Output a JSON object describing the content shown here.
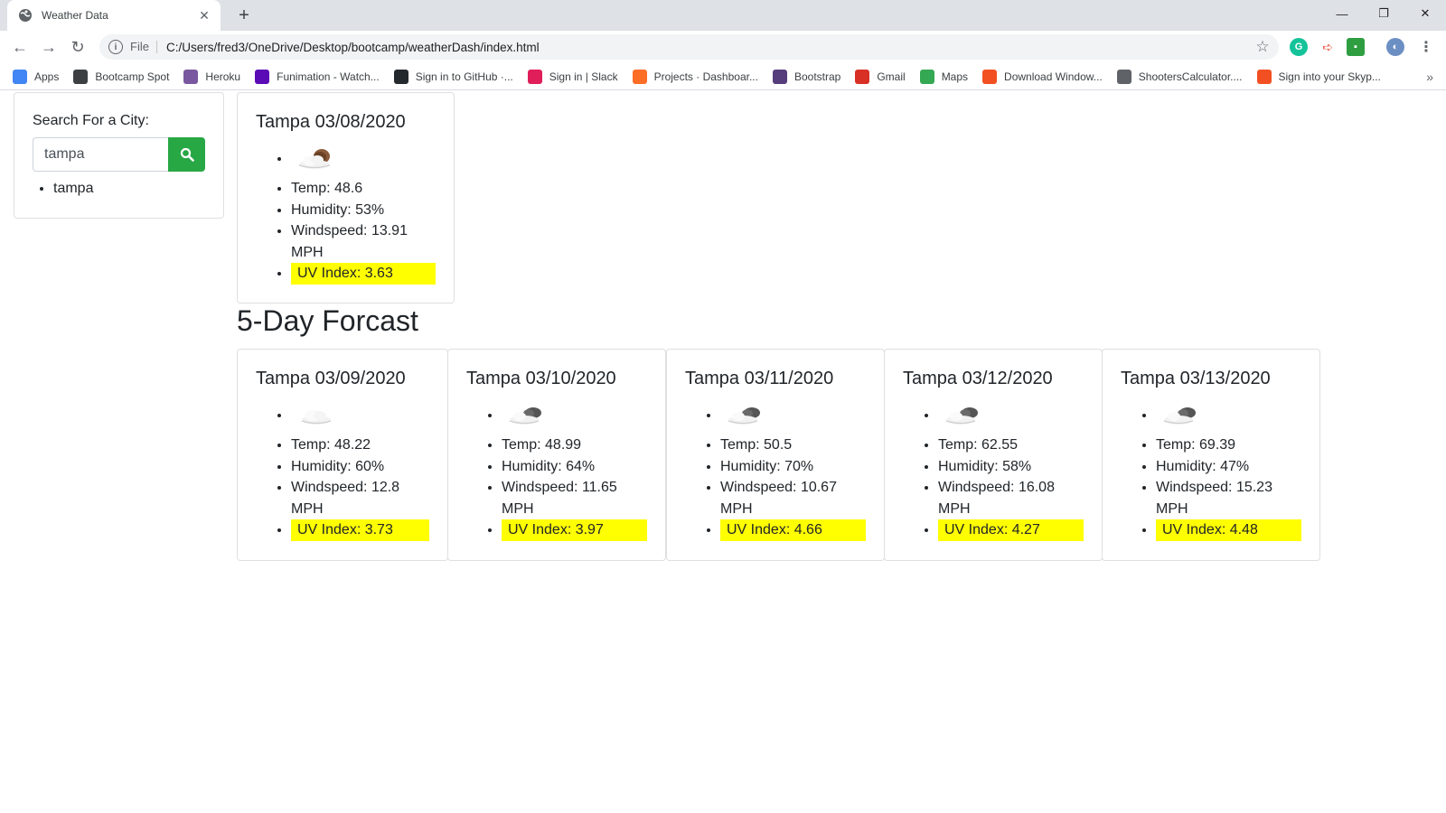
{
  "browser": {
    "tab_title": "Weather Data",
    "url_scheme": "File",
    "url": "C:/Users/fred3/OneDrive/Desktop/bootcamp/weatherDash/index.html",
    "bookmarks": [
      {
        "label": "Apps",
        "icon": "apps-grid-icon",
        "color": "#4285f4"
      },
      {
        "label": "Bootcamp Spot",
        "icon": "bootcamp-spot-icon",
        "color": "#3c4043"
      },
      {
        "label": "Heroku",
        "icon": "heroku-icon",
        "color": "#79589f"
      },
      {
        "label": "Funimation - Watch...",
        "icon": "funimation-icon",
        "color": "#5b0bb5"
      },
      {
        "label": "Sign in to GitHub ·...",
        "icon": "github-icon",
        "color": "#24292e"
      },
      {
        "label": "Sign in | Slack",
        "icon": "slack-icon",
        "color": "#e01e5a"
      },
      {
        "label": "Projects · Dashboar...",
        "icon": "gitlab-icon",
        "color": "#fc6d26"
      },
      {
        "label": "Bootstrap",
        "icon": "bootstrap-icon",
        "color": "#563d7c"
      },
      {
        "label": "Gmail",
        "icon": "gmail-icon",
        "color": "#d93025"
      },
      {
        "label": "Maps",
        "icon": "maps-pin-icon",
        "color": "#34a853"
      },
      {
        "label": "Download Window...",
        "icon": "windows-icon",
        "color": "#f25022"
      },
      {
        "label": "ShootersCalculator....",
        "icon": "crosshair-icon",
        "color": "#5f6368"
      },
      {
        "label": "Sign into your Skyp...",
        "icon": "windows-icon",
        "color": "#f25022"
      }
    ]
  },
  "search": {
    "label": "Search For a City:",
    "value": "tampa",
    "button_color": "#28a745",
    "history": [
      "tampa"
    ]
  },
  "current": {
    "title": "Tampa 03/08/2020",
    "icon": "partly-cloudy-night-icon",
    "temp": "Temp: 48.6",
    "humidity": "Humidity: 53%",
    "windspeed": "Windspeed: 13.91 MPH",
    "uv": "UV Index: 3.63"
  },
  "forecast_title": "5-Day Forcast",
  "forecast": [
    {
      "title": "Tampa 03/09/2020",
      "icon": "cloud-icon",
      "temp": "Temp: 48.22",
      "humidity": "Humidity: 60%",
      "windspeed": "Windspeed: 12.8 MPH",
      "uv": "UV Index: 3.73"
    },
    {
      "title": "Tampa 03/10/2020",
      "icon": "broken-clouds-icon",
      "temp": "Temp: 48.99",
      "humidity": "Humidity: 64%",
      "windspeed": "Windspeed: 11.65 MPH",
      "uv": "UV Index: 3.97"
    },
    {
      "title": "Tampa 03/11/2020",
      "icon": "broken-clouds-icon",
      "temp": "Temp: 50.5",
      "humidity": "Humidity: 70%",
      "windspeed": "Windspeed: 10.67 MPH",
      "uv": "UV Index: 4.66"
    },
    {
      "title": "Tampa 03/12/2020",
      "icon": "broken-clouds-icon",
      "temp": "Temp: 62.55",
      "humidity": "Humidity: 58%",
      "windspeed": "Windspeed: 16.08 MPH",
      "uv": "UV Index: 4.27"
    },
    {
      "title": "Tampa 03/13/2020",
      "icon": "broken-clouds-icon",
      "temp": "Temp: 69.39",
      "humidity": "Humidity: 47%",
      "windspeed": "Windspeed: 15.23 MPH",
      "uv": "UV Index: 4.48"
    }
  ],
  "colors": {
    "uv_highlight": "#ffff00"
  }
}
